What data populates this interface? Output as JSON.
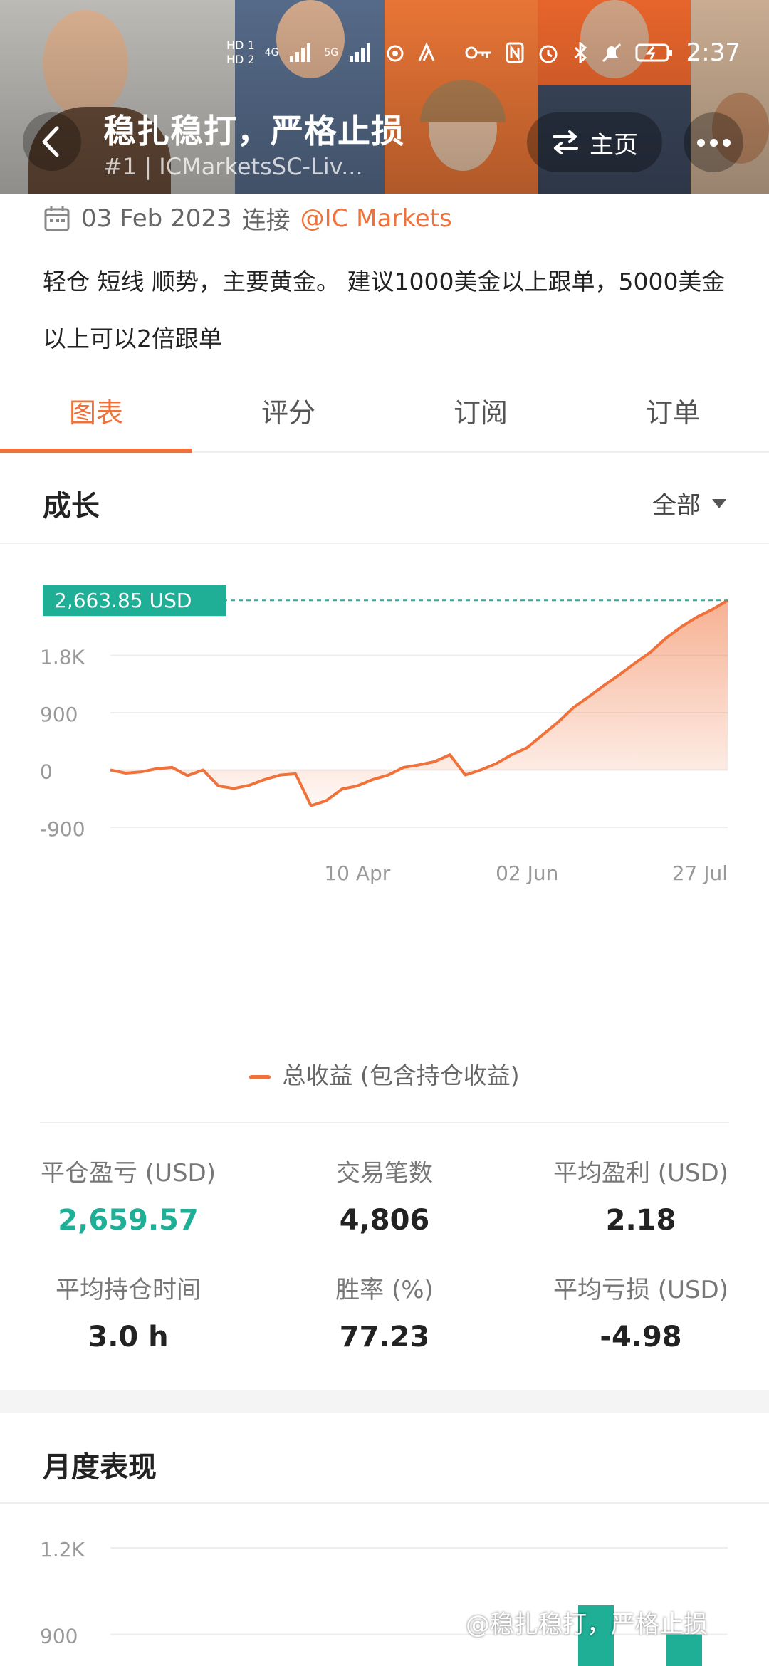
{
  "status_bar": {
    "left_labels": [
      "HD 1",
      "HD 2",
      "4G",
      "5G"
    ],
    "time": "2:37",
    "icons": [
      "key-icon",
      "nfc-icon",
      "alarm-icon",
      "bluetooth-icon",
      "mute-icon",
      "battery-charging-icon"
    ]
  },
  "header": {
    "title": "稳扎稳打，严格止损",
    "subtitle": "#1 | ICMarketsSC-Liv...",
    "home_label": "主页"
  },
  "info": {
    "date": "03 Feb 2023",
    "connect_word": "连接",
    "provider": "@IC Markets",
    "description": "轻仓 短线 顺势，主要黄金。 建议1000美金以上跟单，5000美金以上可以2倍跟单"
  },
  "tabs": [
    {
      "label": "图表",
      "active": true
    },
    {
      "label": "评分",
      "active": false
    },
    {
      "label": "订阅",
      "active": false
    },
    {
      "label": "订单",
      "active": false
    }
  ],
  "growth_section": {
    "title": "成长",
    "filter_label": "全部"
  },
  "chart_data": {
    "type": "area",
    "title": "",
    "current_value_label": "2,663.85 USD",
    "y_ticks": [
      "1.8K",
      "900",
      "0",
      "-900"
    ],
    "x_ticks": [
      "10 Apr",
      "02 Jun",
      "27 Jul"
    ],
    "ylim": [
      -900,
      2700
    ],
    "legend": [
      {
        "name": "总收益 (包含持仓收益)",
        "color": "#f0713a"
      }
    ],
    "series": [
      {
        "name": "总收益 (包含持仓收益)",
        "x": [
          "03 Feb",
          "08 Feb",
          "14 Feb",
          "20 Feb",
          "26 Feb",
          "03 Mar",
          "05 Mar",
          "08 Mar",
          "12 Mar",
          "15 Mar",
          "20 Mar",
          "26 Mar",
          "01 Apr",
          "02 Apr",
          "03 Apr",
          "07 Apr",
          "10 Apr",
          "15 Apr",
          "20 Apr",
          "25 Apr",
          "30 Apr",
          "05 May",
          "10 May",
          "16 May",
          "20 May",
          "22 May",
          "28 May",
          "02 Jun",
          "06 Jun",
          "12 Jun",
          "18 Jun",
          "22 Jun",
          "26 Jun",
          "30 Jun",
          "04 Jul",
          "08 Jul",
          "12 Jul",
          "16 Jul",
          "20 Jul",
          "24 Jul",
          "27 Jul"
        ],
        "values": [
          0,
          -50,
          -30,
          20,
          40,
          -90,
          0,
          -250,
          -290,
          -240,
          -150,
          -80,
          -60,
          -560,
          -480,
          -300,
          -250,
          -150,
          -80,
          40,
          80,
          130,
          240,
          -80,
          0,
          100,
          240,
          350,
          550,
          750,
          980,
          1150,
          1330,
          1500,
          1680,
          1850,
          2070,
          2250,
          2400,
          2520,
          2663.85
        ]
      }
    ]
  },
  "stats": [
    {
      "label": "平仓盈亏 (USD)",
      "value": "2,659.57",
      "positive": true
    },
    {
      "label": "交易笔数",
      "value": "4,806",
      "positive": false
    },
    {
      "label": "平均盈利 (USD)",
      "value": "2.18",
      "positive": false
    },
    {
      "label": "平均持仓时间",
      "value": "3.0 h",
      "positive": false
    },
    {
      "label": "胜率 (%)",
      "value": "77.23",
      "positive": false
    },
    {
      "label": "平均亏损 (USD)",
      "value": "-4.98",
      "positive": false
    }
  ],
  "monthly_section": {
    "title": "月度表现"
  },
  "monthly_chart": {
    "type": "bar",
    "y_ticks": [
      "1.2K",
      "900"
    ],
    "ylim": [
      0,
      1200
    ],
    "values": [
      1000,
      900
    ]
  },
  "watermark": "@稳扎稳打，严格止损",
  "colors": {
    "accent": "#f0713a",
    "positive": "#1fae96",
    "header_bg": "#f36a2e"
  }
}
